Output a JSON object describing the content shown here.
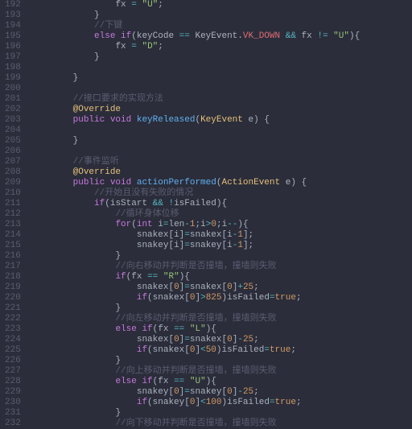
{
  "gutter_start": 192,
  "gutter_end": 232,
  "lines": {
    "192": [
      [
        "i",
        16
      ],
      [
        "var",
        "fx "
      ],
      [
        "op",
        "="
      ],
      [
        "var",
        " "
      ],
      [
        "str",
        "\"U\""
      ],
      [
        "pun",
        ";"
      ]
    ],
    "193": [
      [
        "i",
        12
      ],
      [
        "pun",
        "}"
      ]
    ],
    "194": [
      [
        "i",
        12
      ],
      [
        "cmt",
        "//下键"
      ]
    ],
    "195": [
      [
        "i",
        12
      ],
      [
        "kw",
        "else if"
      ],
      [
        "pun",
        "("
      ],
      [
        "var",
        "keyCode "
      ],
      [
        "op",
        "=="
      ],
      [
        "var",
        " KeyEvent"
      ],
      [
        "pun",
        "."
      ],
      [
        "id",
        "VK_DOWN"
      ],
      [
        "var",
        " "
      ],
      [
        "op",
        "&&"
      ],
      [
        "var",
        " fx "
      ],
      [
        "op",
        "!="
      ],
      [
        "var",
        " "
      ],
      [
        "str",
        "\"U\""
      ],
      [
        "pun",
        "){"
      ]
    ],
    "196": [
      [
        "i",
        16
      ],
      [
        "var",
        "fx "
      ],
      [
        "op",
        "="
      ],
      [
        "var",
        " "
      ],
      [
        "str",
        "\"D\""
      ],
      [
        "pun",
        ";"
      ]
    ],
    "197": [
      [
        "i",
        12
      ],
      [
        "pun",
        "}"
      ]
    ],
    "198": [
      [
        "i",
        0
      ],
      [
        "",
        ""
      ]
    ],
    "199": [
      [
        "i",
        8
      ],
      [
        "pun",
        "}"
      ]
    ],
    "200": [
      [
        "i",
        0
      ],
      [
        "",
        ""
      ]
    ],
    "201": [
      [
        "i",
        8
      ],
      [
        "cmt",
        "//接口要求的实现方法"
      ]
    ],
    "202": [
      [
        "i",
        8
      ],
      [
        "ann",
        "@Override"
      ]
    ],
    "203": [
      [
        "i",
        8
      ],
      [
        "kw",
        "public void "
      ],
      [
        "fn",
        "keyReleased"
      ],
      [
        "pun",
        "("
      ],
      [
        "type",
        "KeyEvent"
      ],
      [
        "var",
        " e"
      ],
      [
        "pun",
        ")"
      ],
      [
        "var",
        " "
      ],
      [
        "pun",
        "{"
      ]
    ],
    "204": [
      [
        "i",
        0
      ],
      [
        "",
        ""
      ]
    ],
    "205": [
      [
        "i",
        8
      ],
      [
        "pun",
        "}"
      ]
    ],
    "206": [
      [
        "i",
        0
      ],
      [
        "",
        ""
      ]
    ],
    "207": [
      [
        "i",
        8
      ],
      [
        "cmt",
        "//事件监听"
      ]
    ],
    "208": [
      [
        "i",
        8
      ],
      [
        "ann",
        "@Override"
      ]
    ],
    "209": [
      [
        "i",
        8
      ],
      [
        "kw",
        "public void "
      ],
      [
        "fn",
        "actionPerformed"
      ],
      [
        "pun",
        "("
      ],
      [
        "type",
        "ActionEvent"
      ],
      [
        "var",
        " e"
      ],
      [
        "pun",
        ")"
      ],
      [
        "var",
        " "
      ],
      [
        "pun",
        "{"
      ]
    ],
    "210": [
      [
        "i",
        12
      ],
      [
        "cmt",
        "//开始且没有失败的情况"
      ]
    ],
    "211": [
      [
        "i",
        12
      ],
      [
        "kw",
        "if"
      ],
      [
        "pun",
        "("
      ],
      [
        "var",
        "isStart "
      ],
      [
        "op",
        "&&"
      ],
      [
        "var",
        " "
      ],
      [
        "op",
        "!"
      ],
      [
        "var",
        "isFailed"
      ],
      [
        "pun",
        "){"
      ]
    ],
    "212": [
      [
        "i",
        16
      ],
      [
        "cmt",
        "//循环身体位移"
      ]
    ],
    "213": [
      [
        "i",
        16
      ],
      [
        "kw",
        "for"
      ],
      [
        "pun",
        "("
      ],
      [
        "kw",
        "int"
      ],
      [
        "var",
        " i"
      ],
      [
        "op",
        "="
      ],
      [
        "var",
        "len"
      ],
      [
        "op",
        "-"
      ],
      [
        "num",
        "1"
      ],
      [
        "pun",
        ";"
      ],
      [
        "var",
        "i"
      ],
      [
        "op",
        ">"
      ],
      [
        "num",
        "0"
      ],
      [
        "pun",
        ";"
      ],
      [
        "var",
        "i"
      ],
      [
        "op",
        "--"
      ],
      [
        "pun",
        "){"
      ]
    ],
    "214": [
      [
        "i",
        20
      ],
      [
        "var",
        "snakex"
      ],
      [
        "pun",
        "["
      ],
      [
        "var",
        "i"
      ],
      [
        "pun",
        "]"
      ],
      [
        "op",
        "="
      ],
      [
        "var",
        "snakex"
      ],
      [
        "pun",
        "["
      ],
      [
        "var",
        "i"
      ],
      [
        "op",
        "-"
      ],
      [
        "num",
        "1"
      ],
      [
        "pun",
        "];"
      ]
    ],
    "215": [
      [
        "i",
        20
      ],
      [
        "var",
        "snakey"
      ],
      [
        "pun",
        "["
      ],
      [
        "var",
        "i"
      ],
      [
        "pun",
        "]"
      ],
      [
        "op",
        "="
      ],
      [
        "var",
        "snakey"
      ],
      [
        "pun",
        "["
      ],
      [
        "var",
        "i"
      ],
      [
        "op",
        "-"
      ],
      [
        "num",
        "1"
      ],
      [
        "pun",
        "];"
      ]
    ],
    "216": [
      [
        "i",
        16
      ],
      [
        "pun",
        "}"
      ]
    ],
    "217": [
      [
        "i",
        16
      ],
      [
        "cmt",
        "//向右移动并判断是否撞墙，撞墙则失败"
      ]
    ],
    "218": [
      [
        "i",
        16
      ],
      [
        "kw",
        "if"
      ],
      [
        "pun",
        "("
      ],
      [
        "var",
        "fx "
      ],
      [
        "op",
        "=="
      ],
      [
        "var",
        " "
      ],
      [
        "str",
        "\"R\""
      ],
      [
        "pun",
        "){"
      ]
    ],
    "219": [
      [
        "i",
        20
      ],
      [
        "var",
        "snakex"
      ],
      [
        "pun",
        "["
      ],
      [
        "num",
        "0"
      ],
      [
        "pun",
        "]"
      ],
      [
        "op",
        "="
      ],
      [
        "var",
        "snakex"
      ],
      [
        "pun",
        "["
      ],
      [
        "num",
        "0"
      ],
      [
        "pun",
        "]"
      ],
      [
        "op",
        "+"
      ],
      [
        "num",
        "25"
      ],
      [
        "pun",
        ";"
      ]
    ],
    "220": [
      [
        "i",
        20
      ],
      [
        "kw",
        "if"
      ],
      [
        "pun",
        "("
      ],
      [
        "var",
        "snakex"
      ],
      [
        "pun",
        "["
      ],
      [
        "num",
        "0"
      ],
      [
        "pun",
        "]"
      ],
      [
        "op",
        ">"
      ],
      [
        "num",
        "825"
      ],
      [
        "pun",
        ")"
      ],
      [
        "var",
        "isFailed"
      ],
      [
        "op",
        "="
      ],
      [
        "bool",
        "true"
      ],
      [
        "pun",
        ";"
      ]
    ],
    "221": [
      [
        "i",
        16
      ],
      [
        "pun",
        "}"
      ]
    ],
    "222": [
      [
        "i",
        16
      ],
      [
        "cmt",
        "//向左移动并判断是否撞墙，撞墙则失败"
      ]
    ],
    "223": [
      [
        "i",
        16
      ],
      [
        "kw",
        "else if"
      ],
      [
        "pun",
        "("
      ],
      [
        "var",
        "fx "
      ],
      [
        "op",
        "=="
      ],
      [
        "var",
        " "
      ],
      [
        "str",
        "\"L\""
      ],
      [
        "pun",
        "){"
      ]
    ],
    "224": [
      [
        "i",
        20
      ],
      [
        "var",
        "snakex"
      ],
      [
        "pun",
        "["
      ],
      [
        "num",
        "0"
      ],
      [
        "pun",
        "]"
      ],
      [
        "op",
        "="
      ],
      [
        "var",
        "snakex"
      ],
      [
        "pun",
        "["
      ],
      [
        "num",
        "0"
      ],
      [
        "pun",
        "]"
      ],
      [
        "op",
        "-"
      ],
      [
        "num",
        "25"
      ],
      [
        "pun",
        ";"
      ]
    ],
    "225": [
      [
        "i",
        20
      ],
      [
        "kw",
        "if"
      ],
      [
        "pun",
        "("
      ],
      [
        "var",
        "snakex"
      ],
      [
        "pun",
        "["
      ],
      [
        "num",
        "0"
      ],
      [
        "pun",
        "]"
      ],
      [
        "op",
        "<"
      ],
      [
        "num",
        "50"
      ],
      [
        "pun",
        ")"
      ],
      [
        "var",
        "isFailed"
      ],
      [
        "op",
        "="
      ],
      [
        "bool",
        "true"
      ],
      [
        "pun",
        ";"
      ]
    ],
    "226": [
      [
        "i",
        16
      ],
      [
        "pun",
        "}"
      ]
    ],
    "227": [
      [
        "i",
        16
      ],
      [
        "cmt",
        "//向上移动并判断是否撞墙，撞墙则失败"
      ]
    ],
    "228": [
      [
        "i",
        16
      ],
      [
        "kw",
        "else if"
      ],
      [
        "pun",
        "("
      ],
      [
        "var",
        "fx "
      ],
      [
        "op",
        "=="
      ],
      [
        "var",
        " "
      ],
      [
        "str",
        "\"U\""
      ],
      [
        "pun",
        "){"
      ]
    ],
    "229": [
      [
        "i",
        20
      ],
      [
        "var",
        "snakey"
      ],
      [
        "pun",
        "["
      ],
      [
        "num",
        "0"
      ],
      [
        "pun",
        "]"
      ],
      [
        "op",
        "="
      ],
      [
        "var",
        "snakey"
      ],
      [
        "pun",
        "["
      ],
      [
        "num",
        "0"
      ],
      [
        "pun",
        "]"
      ],
      [
        "op",
        "-"
      ],
      [
        "num",
        "25"
      ],
      [
        "pun",
        ";"
      ]
    ],
    "230": [
      [
        "i",
        20
      ],
      [
        "kw",
        "if"
      ],
      [
        "pun",
        "("
      ],
      [
        "var",
        "snakey"
      ],
      [
        "pun",
        "["
      ],
      [
        "num",
        "0"
      ],
      [
        "pun",
        "]"
      ],
      [
        "op",
        "<"
      ],
      [
        "num",
        "100"
      ],
      [
        "pun",
        ")"
      ],
      [
        "var",
        "isFailed"
      ],
      [
        "op",
        "="
      ],
      [
        "bool",
        "true"
      ],
      [
        "pun",
        ";"
      ]
    ],
    "231": [
      [
        "i",
        16
      ],
      [
        "pun",
        "}"
      ]
    ],
    "232": [
      [
        "i",
        16
      ],
      [
        "cmt",
        "//向下移动并判断是否撞墙，撞墙则失败"
      ]
    ]
  }
}
